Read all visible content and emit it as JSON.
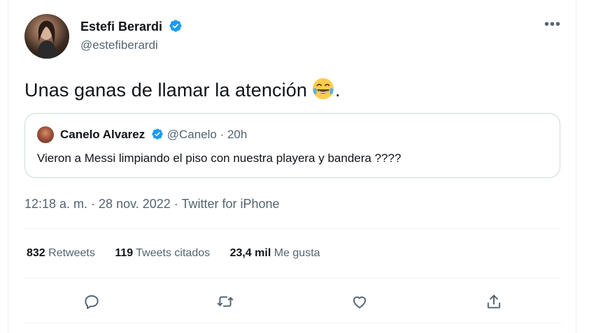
{
  "tweet": {
    "author_name": "Estefi Berardi",
    "author_handle": "@estefiberardi",
    "more_label": "•••",
    "text": "Unas ganas de llamar la atención",
    "text_after_emoji": ".",
    "emoji": "face-with-tears-of-joy",
    "timestamp": "12:18 a. m. · 28 nov. 2022 · Twitter for iPhone"
  },
  "quote": {
    "author_name": "Canelo Alvarez",
    "meta": "@Canelo · 20h",
    "text": "Vieron a Messi limpiando el piso con nuestra playera y bandera ????"
  },
  "stats": {
    "retweets_count": "832",
    "retweets_label": "Retweets",
    "quotes_count": "119",
    "quotes_label": "Tweets citados",
    "likes_count": "23,4 mil",
    "likes_label": "Me gusta"
  },
  "actions": [
    "reply-icon",
    "retweet-icon",
    "like-icon",
    "share-icon"
  ],
  "colors": {
    "verified": "#1d9bf0",
    "secondary_text": "#536471",
    "border": "#cfd9de"
  }
}
